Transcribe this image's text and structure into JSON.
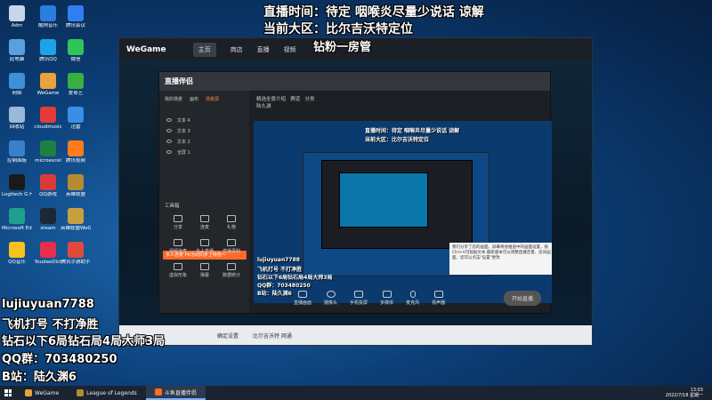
{
  "overlay": {
    "top_line1": "直播时间：待定 咽喉炎尽量少说话 谅解",
    "top_line2": "当前大区：比尔吉沃特定位",
    "top_line3": "钻粉一房管",
    "bottom_lines": [
      "lujiuyuan7788",
      "飞机打号 不打净胜",
      "钻石以下6局钻石局4局大师3局",
      "QQ群：703480250",
      "B站：陆久渊6"
    ]
  },
  "desktop_icons": [
    {
      "label": "Adm",
      "color": "#c9d6e8"
    },
    {
      "label": "此电脑",
      "color": "#5aa0e0"
    },
    {
      "label": "网络",
      "color": "#3d8fd8"
    },
    {
      "label": "回收站",
      "color": "#9ab8d8"
    },
    {
      "label": "控制面板",
      "color": "#3a7fc9"
    },
    {
      "label": "Logitech G HUB",
      "color": "#1a1a1a"
    },
    {
      "label": "Microsoft Edge",
      "color": "#1f9f8f"
    },
    {
      "label": "QQ音乐",
      "color": "#f6c21b"
    },
    {
      "label": "酷狗音乐",
      "color": "#2a7de1"
    },
    {
      "label": "腾讯QQ",
      "color": "#1fa3e8"
    },
    {
      "label": "WeGame",
      "color": "#e8a33d"
    },
    {
      "label": "cloudmusic",
      "color": "#e53a3a"
    },
    {
      "label": "microexcel",
      "color": "#1d7f43"
    },
    {
      "label": "QQ游戏",
      "color": "#d83a3a"
    },
    {
      "label": "steam",
      "color": "#1b2838"
    },
    {
      "label": "YoudaoDict",
      "color": "#e62e4d"
    },
    {
      "label": "腾讯会议",
      "color": "#2f7ff0"
    },
    {
      "label": "微信",
      "color": "#2ec55b"
    },
    {
      "label": "爱奇艺",
      "color": "#38b03f"
    },
    {
      "label": "迅雷",
      "color": "#3a8ee6"
    },
    {
      "label": "腾讯视频",
      "color": "#ff7b1c"
    },
    {
      "label": "英雄联盟",
      "color": "#b78a2f"
    },
    {
      "label": "英雄联盟WeGame版",
      "color": "#c8a040"
    },
    {
      "label": "腾讯手游助手",
      "color": "#e04a3a"
    }
  ],
  "wegame": {
    "logo": "WeGame",
    "tabs": [
      "主页",
      "商店",
      "直播",
      "视频"
    ],
    "status_text": "比尔吉沃特 网通",
    "status_btn": "确定设置"
  },
  "assistant": {
    "title": "直播伴侣",
    "left_tabs": [
      "我的场景",
      "画布",
      "场景源"
    ],
    "sources": [
      "文本 4",
      "文本 3",
      "文本 2",
      "全屏 1"
    ],
    "tools_title": "工具箱",
    "tools": [
      "分享",
      "连麦",
      "礼物",
      "视频连麦",
      "多人直播",
      "直播录制",
      "虚拟形象",
      "弹幕",
      "数据统计"
    ],
    "promo": "多人连麦 PK活动同步上线啦～",
    "top_labels": [
      "精选全景介绍",
      "赛道",
      "分类"
    ],
    "top_meta": "陆久渊",
    "controls": [
      "直播画面",
      "摄像头",
      "手机投屏",
      "多媒体",
      "麦克风",
      "扬声器"
    ],
    "start_btn": "开始直播",
    "tip_text": "我们分享了您的画面，屏幕将会推送中的画面设置，按Ctrl+V可粘贴文本 最新版本可以调整直播音量、房间画面，您可以点击\"设置\"更改"
  },
  "taskbar": {
    "items": [
      "WeGame",
      "League of Legends",
      "斗鱼直播伴侣"
    ],
    "time": "13:03",
    "date": "2022/7/18 星期一"
  }
}
